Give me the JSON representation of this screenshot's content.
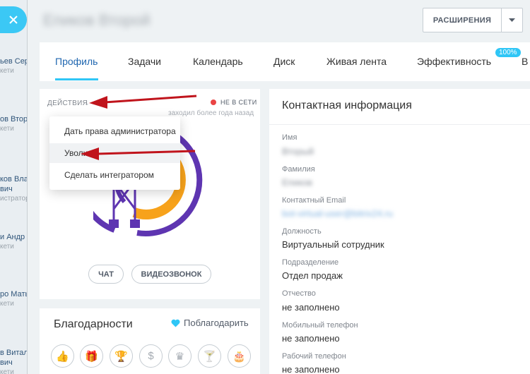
{
  "background_list": [
    {
      "name": "ьев Сер",
      "sub": "кети"
    },
    {
      "name": "ов Втор",
      "sub": "кети"
    },
    {
      "name": "ков Влад",
      "sub": "вич",
      "sub2": "истратор"
    },
    {
      "name": "и Андр",
      "sub": "кети"
    },
    {
      "name": "ро Маты",
      "sub": "кети"
    },
    {
      "name": "в Витали",
      "sub": "вич",
      "sub2": "кети"
    }
  ],
  "header": {
    "title": "Епиков Второй",
    "extensions_label": "РАСШИРЕНИЯ"
  },
  "tabs": [
    {
      "label": "Профиль",
      "active": true
    },
    {
      "label": "Задачи"
    },
    {
      "label": "Календарь"
    },
    {
      "label": "Диск"
    },
    {
      "label": "Живая лента"
    },
    {
      "label": "Эффективность",
      "badge": "100%"
    },
    {
      "label": "В"
    }
  ],
  "profile": {
    "actions_label": "ДЕЙСТВИЯ",
    "status": "НЕ В СЕТИ",
    "last_seen": "заходил более года назад",
    "chat_button": "ЧАТ",
    "video_button": "ВИДЕОЗВОНОК"
  },
  "actions_menu": [
    "Дать права администратора",
    "Уволить",
    "Сделать интегратором"
  ],
  "thanks": {
    "title": "Благодарности",
    "thank_link": "Поблагодарить",
    "gift_icons": [
      "thumbs-up-icon",
      "gift-icon",
      "cup-icon",
      "money-bag-icon",
      "crown-icon",
      "cocktail-icon",
      "cake-icon"
    ]
  },
  "contact": {
    "title": "Контактная информация",
    "fields": [
      {
        "label": "Имя",
        "value": "Вторый"
      },
      {
        "label": "Фамилия",
        "value": "Епиков"
      },
      {
        "label": "Контактный Email",
        "value": "bot-virtual-user@bitrix24.ru"
      },
      {
        "label": "Должность",
        "value": "Виртуальный сотрудник"
      },
      {
        "label": "Подразделение",
        "value": "Отдел продаж"
      },
      {
        "label": "Отчество",
        "value": "не заполнено"
      },
      {
        "label": "Мобильный телефон",
        "value": "не заполнено"
      },
      {
        "label": "Рабочий телефон",
        "value": "не заполнено"
      }
    ]
  },
  "colors": {
    "accent": "#2fc6f6",
    "active_tab": "#2067b0",
    "logo_purple": "#5e35b1",
    "logo_orange": "#f7a21b",
    "arrow_red": "#c0141c",
    "offline_dot": "#ea4444"
  }
}
